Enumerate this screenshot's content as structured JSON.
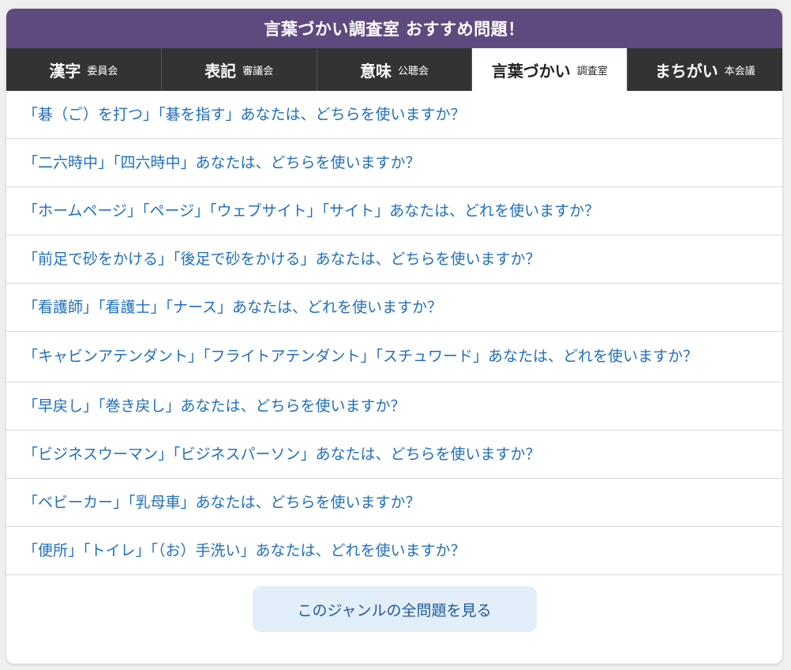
{
  "header": {
    "title": "言葉づかい調査室 おすすめ問題！"
  },
  "tabs": [
    {
      "label": "漢字",
      "sub": "委員会",
      "active": false
    },
    {
      "label": "表記",
      "sub": "審議会",
      "active": false
    },
    {
      "label": "意味",
      "sub": "公聴会",
      "active": false
    },
    {
      "label": "言葉づかい",
      "sub": "調査室",
      "active": true
    },
    {
      "label": "まちがい",
      "sub": "本会議",
      "active": false
    }
  ],
  "questions": [
    "「碁（ご）を打つ」「碁を指す」あなたは、どちらを使いますか？",
    "「二六時中」「四六時中」あなたは、どちらを使いますか？",
    "「ホームページ」「ページ」「ウェブサイト」「サイト」あなたは、どれを使いますか？",
    "「前足で砂をかける」「後足で砂をかける」あなたは、どちらを使いますか？",
    "「看護師」「看護士」「ナース」あなたは、どれを使いますか？",
    "「キャビンアテンダント」「フライトアテンダント」「スチュワード」あなたは、どれを使いますか？",
    "「早戻し」「巻き戻し」あなたは、どちらを使いますか？",
    "「ビジネスウーマン」「ビジネスパーソン」あなたは、どちらを使いますか？",
    "「ベビーカー」「乳母車」あなたは、どちらを使いますか？",
    "「便所」「トイレ」「（お）手洗い」あなたは、どれを使いますか？"
  ],
  "footer": {
    "more_label": "このジャンルの全問題を見る"
  },
  "colors": {
    "header_bg": "#5f4a80",
    "tab_bg": "#333333",
    "link": "#1f6fbf",
    "button_bg": "#e3eefb"
  }
}
